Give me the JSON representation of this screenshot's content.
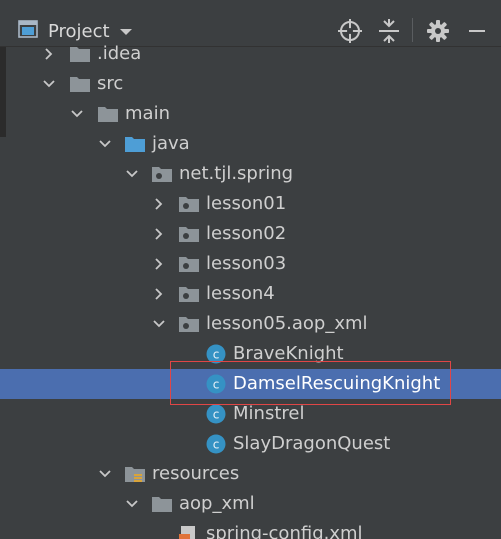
{
  "header": {
    "title": "Project",
    "icons": [
      "project-icon",
      "dropdown-caret-icon",
      "locate-icon",
      "collapse-all-icon",
      "settings-icon",
      "hide-icon"
    ]
  },
  "tree": [
    {
      "label": ".idea",
      "icon": "folder",
      "chevron": "right"
    },
    {
      "label": "src",
      "icon": "folder",
      "chevron": "down"
    },
    {
      "label": "main",
      "icon": "folder",
      "chevron": "down"
    },
    {
      "label": "java",
      "icon": "source-folder",
      "chevron": "down"
    },
    {
      "label": "net.tjl.spring",
      "icon": "package",
      "chevron": "down"
    },
    {
      "label": "lesson01",
      "icon": "package",
      "chevron": "right"
    },
    {
      "label": "lesson02",
      "icon": "package",
      "chevron": "right"
    },
    {
      "label": "lesson03",
      "icon": "package",
      "chevron": "right"
    },
    {
      "label": "lesson4",
      "icon": "package",
      "chevron": "right"
    },
    {
      "label": "lesson05.aop_xml",
      "icon": "package",
      "chevron": "down"
    },
    {
      "label": "BraveKnight",
      "icon": "class",
      "chevron": "none"
    },
    {
      "label": "DamselRescuingKnight",
      "icon": "class",
      "chevron": "none",
      "selected": true
    },
    {
      "label": "Minstrel",
      "icon": "class",
      "chevron": "none"
    },
    {
      "label": "SlayDragonQuest",
      "icon": "class",
      "chevron": "none"
    },
    {
      "label": "resources",
      "icon": "resources-folder",
      "chevron": "down"
    },
    {
      "label": "aop_xml",
      "icon": "folder",
      "chevron": "down"
    },
    {
      "label": "spring-config.xml",
      "icon": "xml-file",
      "chevron": "none"
    }
  ],
  "colors": {
    "panel_bg": "#3c3f41",
    "selection": "#4b6eaf",
    "text": "#cfcfcf",
    "folder": "#8d9499",
    "source_folder": "#4e9ed6",
    "class_icon": "#3592c4",
    "annotation_box": "#e04646"
  }
}
